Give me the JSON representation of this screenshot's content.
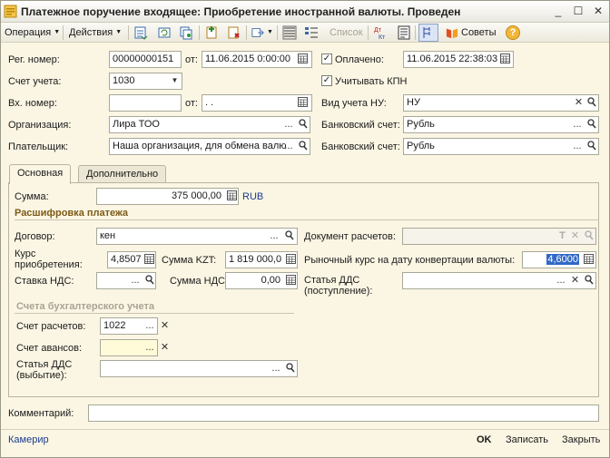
{
  "window": {
    "title": "Платежное поручение входящее: Приобретение иностранной валюты. Проведен"
  },
  "toolbar": {
    "operation": "Операция",
    "actions": "Действия",
    "search": "Список",
    "tips": "Советы"
  },
  "header": {
    "reg_number_label": "Рег. номер:",
    "reg_number": "00000000151",
    "from_label": "от:",
    "reg_date": "11.06.2015  0:00:00",
    "paid_label": "Оплачено:",
    "paid_checked": "✓",
    "paid_date": "11.06.2015 22:38:03",
    "account_label": "Счет учета:",
    "account": "1030",
    "kpn_label": "Учитывать КПН",
    "kpn_checked": "✓",
    "in_number_label": "Вх. номер:",
    "in_number": "",
    "in_from_label": "от:",
    "in_date": "  .  .",
    "nu_label": "Вид учета НУ:",
    "nu_value": "НУ",
    "org_label": "Организация:",
    "org_value": "Лира ТОО",
    "bank1_label": "Банковский счет:",
    "bank1_value": "Рубль",
    "payer_label": "Плательщик:",
    "payer_value": "Наша организация, для обмена валю",
    "bank2_label": "Банковский счет:",
    "bank2_value": "Рубль"
  },
  "tabs": [
    {
      "label": "Основная"
    },
    {
      "label": "Дополнительно"
    }
  ],
  "main": {
    "sum_label": "Сумма:",
    "sum_value": "375 000,00",
    "currency": "RUB",
    "breakdown_title": "Расшифровка платежа",
    "contract_label": "Договор:",
    "contract_value": "кен",
    "doc_label": "Документ расчетов:",
    "doc_value": "",
    "rate_label": "Курс приобретения:",
    "rate_value": "4,8507",
    "sum_kzt_label": "Сумма KZT:",
    "sum_kzt_value": "1 819 000,0",
    "market_rate_label": "Рыночный курс на дату конвертации валюты:",
    "market_rate_value": "4,6000",
    "vat_rate_label": "Ставка НДС:",
    "vat_rate_value": "",
    "vat_sum_label": "Сумма НДС:",
    "vat_sum_value": "0,00",
    "dds_in_label": "Статья ДДС (поступление):",
    "dds_in_value": "",
    "accounting_title": "Счета бухгалтерского учета",
    "settle_acc_label": "Счет расчетов:",
    "settle_acc_value": "1022",
    "advance_acc_label": "Счет авансов:",
    "advance_acc_value": "",
    "dds_out_label": "Статья ДДС (выбытие):",
    "dds_out_value": ""
  },
  "footer": {
    "comment_label": "Комментарий:",
    "comment_value": "",
    "user": "Камерир",
    "ok": "OK",
    "save": "Записать",
    "close": "Закрыть"
  },
  "colors": {
    "background": "#fbf6e4",
    "section_title": "#7c5a16",
    "link": "#1a3c8c",
    "selection": "#3169c6"
  }
}
